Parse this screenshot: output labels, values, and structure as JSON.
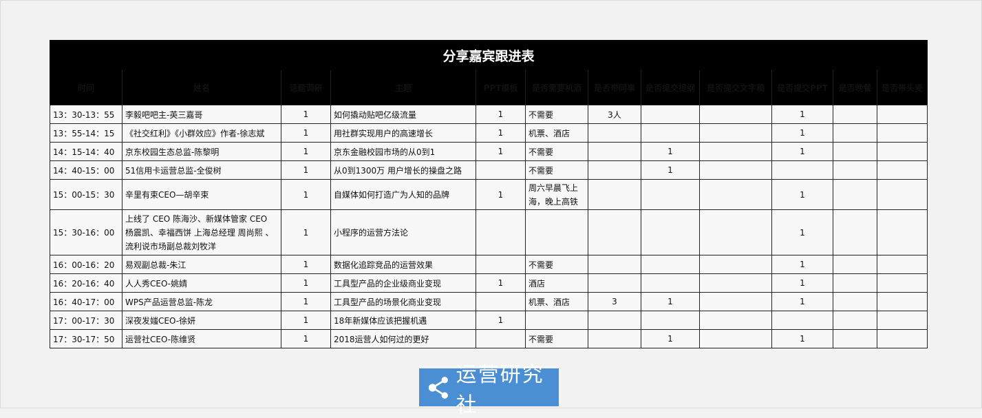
{
  "title": "分享嘉宾跟进表",
  "headers": [
    "时间",
    "姓名",
    "话题调研",
    "主题",
    "PPT模板",
    "是否需要机酒",
    "是否带同事",
    "是否提交提纲",
    "是否提交文字稿",
    "是否提交PPT",
    "是否晚餐",
    "是否带头麦"
  ],
  "rows": [
    [
      "13：30-13：55",
      "李毅吧吧主-英三嘉哥",
      "1",
      "如何撬动贴吧亿级流量",
      "1",
      "不需要",
      "3人",
      "",
      "",
      "1",
      "",
      ""
    ],
    [
      "13：55-14：15",
      "《社交红利》《小群效应》作者-徐志斌",
      "1",
      "用社群实现用户的高速增长",
      "1",
      "机票、酒店",
      "",
      "",
      "",
      "1",
      "",
      ""
    ],
    [
      "14：15-14：40",
      "京东校园生态总监-陈黎明",
      "1",
      "京东金融校园市场的从0到1",
      "1",
      "不需要",
      "",
      "1",
      "",
      "1",
      "",
      ""
    ],
    [
      "14：40-15：00",
      "51信用卡运营总监-全俊树",
      "1",
      "从0到1300万 用户增长的操盘之路",
      "",
      "不需要",
      "",
      "1",
      "",
      "",
      "",
      ""
    ],
    [
      "15：00-15：30",
      "辛里有束CEO—胡辛束",
      "1",
      "自媒体如何打造广为人知的品牌",
      "1",
      "周六早晨飞上海，晚上高铁",
      "",
      "",
      "",
      "1",
      "",
      ""
    ],
    [
      "15：30-16：00",
      "上线了 CEO 陈海沙、新媒体管家 CEO 杨震凯、幸福西饼 上海总经理 周尚熙 、流利说市场副总裁刘牧洋",
      "1",
      "小程序的运营方法论",
      "",
      "",
      "",
      "",
      "",
      "1",
      "",
      ""
    ],
    [
      "16：00-16：20",
      "易观副总裁-朱江",
      "1",
      "数据化追踪竞品的运营效果",
      "",
      "不需要",
      "",
      "",
      "",
      "1",
      "",
      ""
    ],
    [
      "16：20-16：40",
      "人人秀CEO-姚婧",
      "1",
      "工具型产品的企业级商业变现",
      "1",
      "酒店",
      "",
      "",
      "",
      "1",
      "",
      ""
    ],
    [
      "16：40-17：00",
      "WPS产品运营总监-陈龙",
      "1",
      "工具型产品的场景化商业变现",
      "",
      "机票、酒店",
      "3",
      "1",
      "",
      "1",
      "",
      ""
    ],
    [
      "17：00-17：30",
      "深夜发媸CEO-徐妍",
      "1",
      "18年新媒体应该把握机遇",
      "1",
      "",
      "",
      "",
      "",
      "",
      "",
      ""
    ],
    [
      "17：30-17：50",
      "运营社CEO-陈维贤",
      "1",
      "2018运营人如何过的更好",
      "",
      "不需要",
      "",
      "1",
      "",
      "1",
      "",
      ""
    ]
  ],
  "logo": {
    "text": "运营研究社",
    "icon": "share-icon",
    "color": "#4a8fd4"
  }
}
